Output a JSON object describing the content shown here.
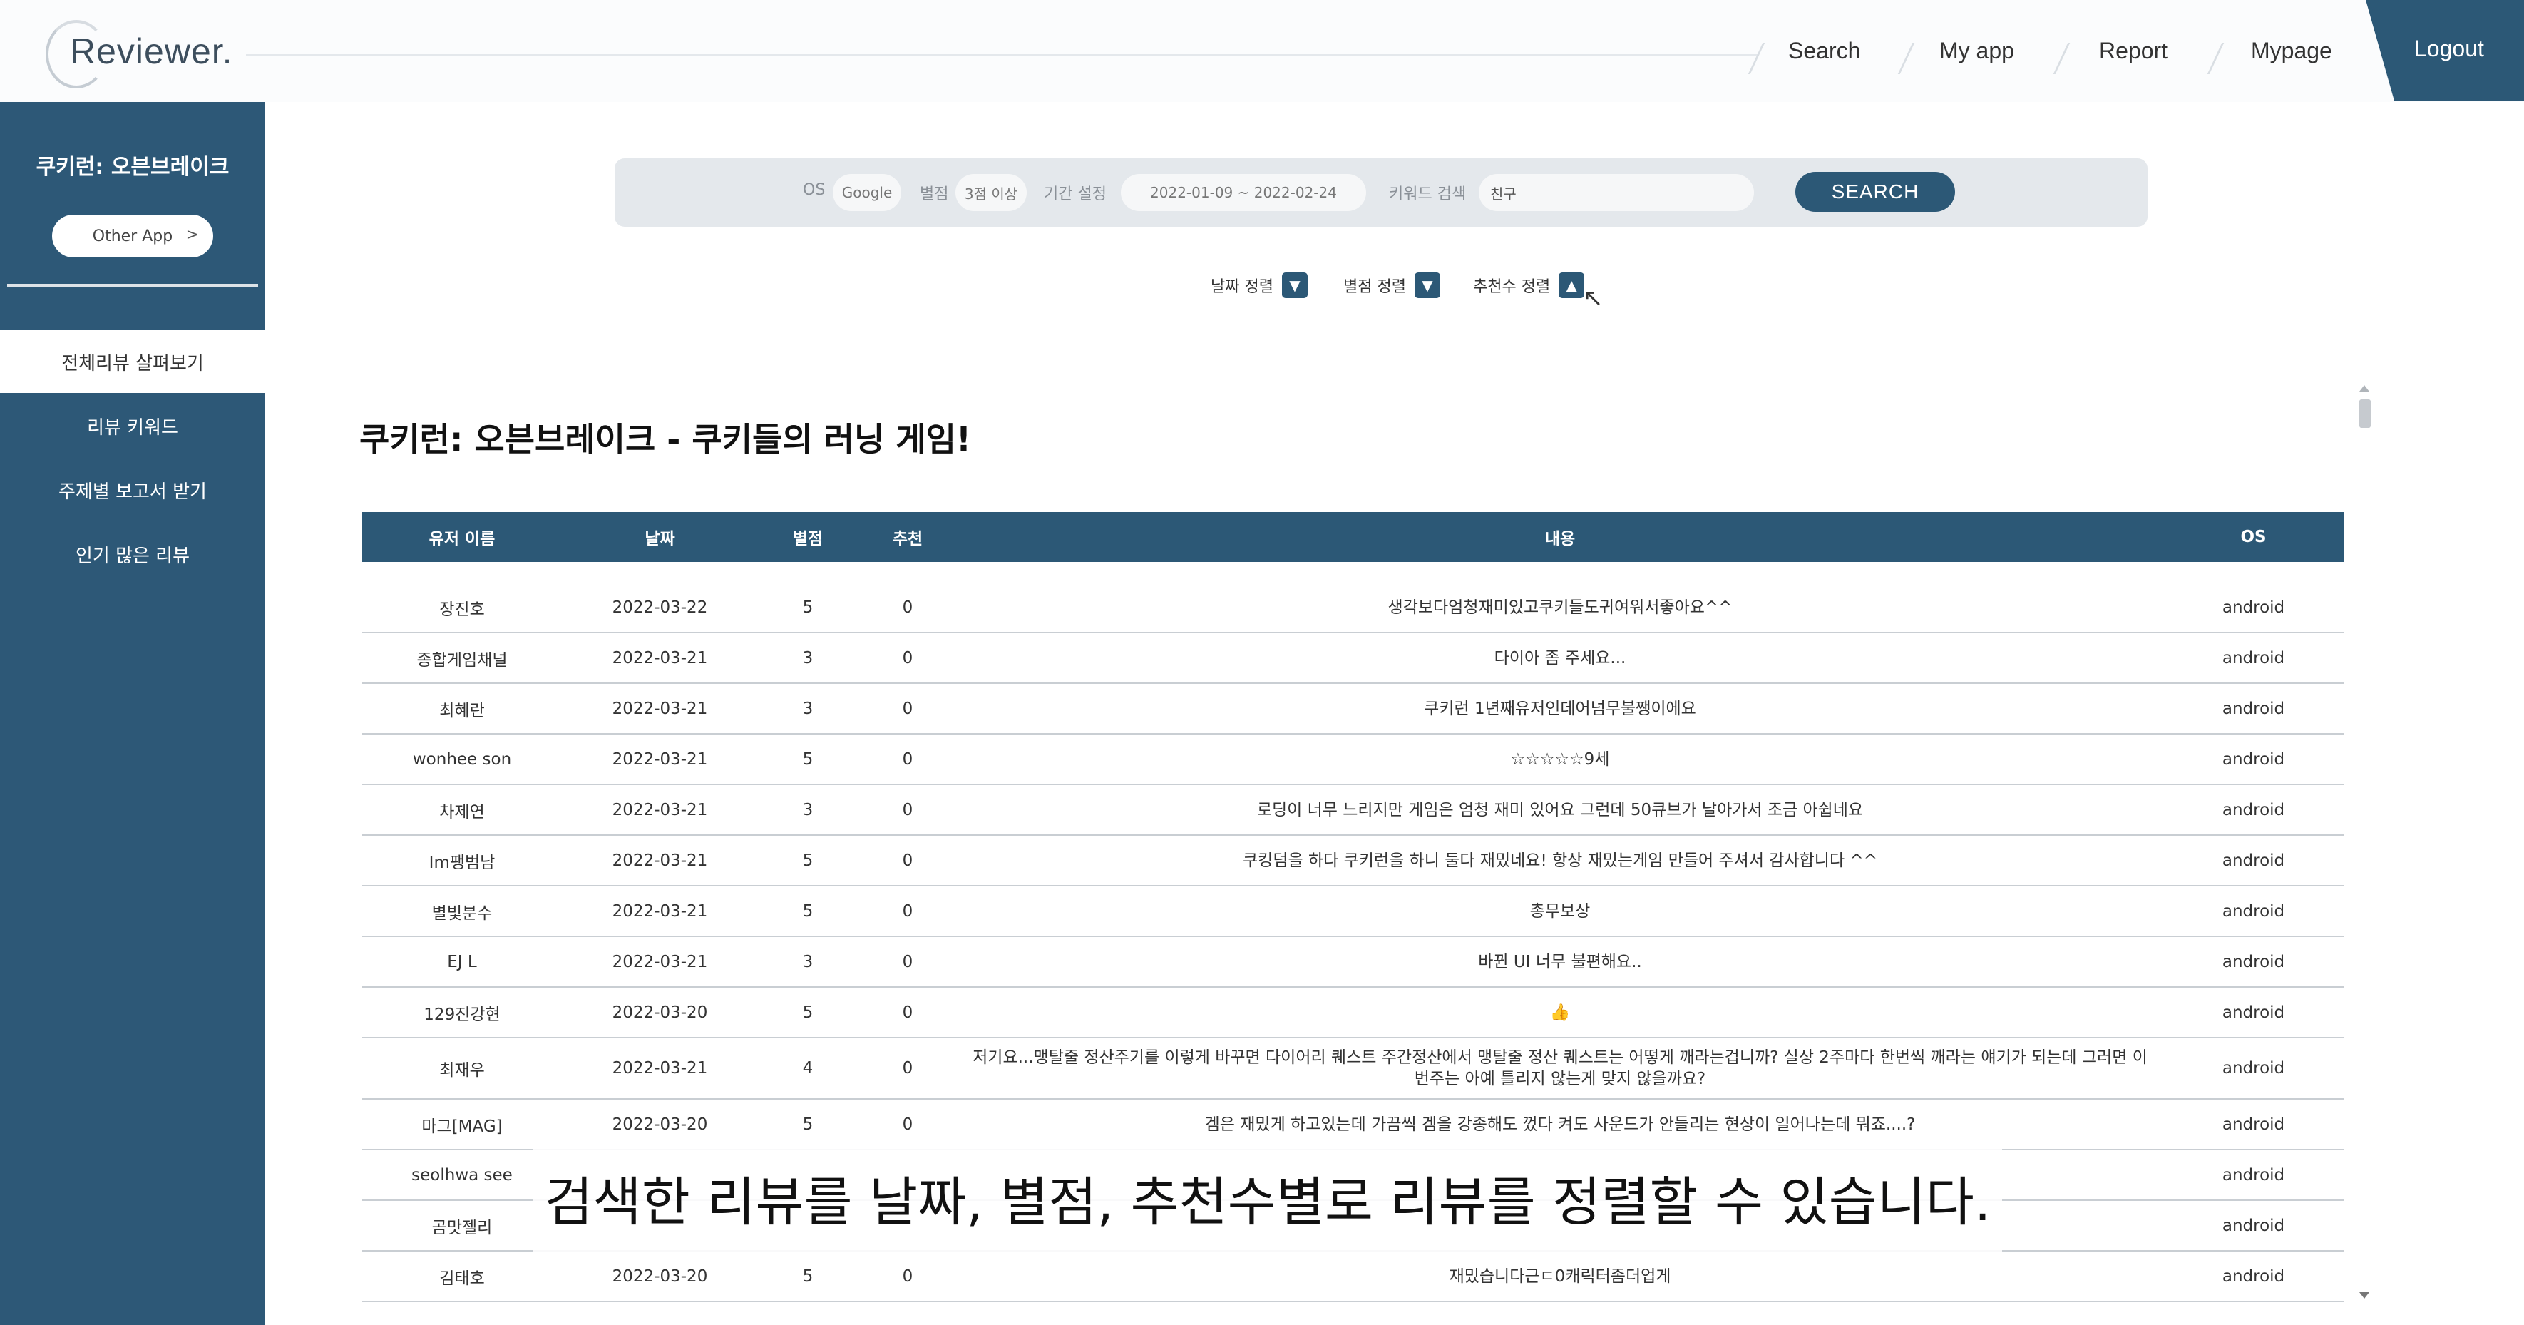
{
  "header": {
    "logo": "Reviewer.",
    "nav": [
      "Search",
      "My app",
      "Report",
      "Mypage"
    ],
    "logout": "Logout"
  },
  "sidebar": {
    "app_name": "쿠키런: 오븐브레이크",
    "other_app": "Other App",
    "other_app_arrow": ">",
    "items": [
      {
        "label": "전체리뷰 살펴보기",
        "active": true
      },
      {
        "label": "리뷰 키워드",
        "active": false
      },
      {
        "label": "주제별 보고서 받기",
        "active": false
      },
      {
        "label": "인기 많은 리뷰",
        "active": false
      }
    ]
  },
  "filter": {
    "os_label": "OS",
    "os_value": "Google",
    "rating_label": "별점",
    "rating_value": "3점 이상",
    "period_label": "기간 설정",
    "period_value": "2022-01-09 ~ 2022-02-24",
    "keyword_label": "키워드 검색",
    "keyword_value": "친구",
    "search_button": "SEARCH"
  },
  "sort": {
    "date": "날짜 정렬",
    "rating": "별점 정렬",
    "recommend": "추천수 정렬",
    "down_glyph": "▼",
    "up_glyph": "▲"
  },
  "page_title": "쿠키런: 오븐브레이크 - 쿠키들의 러닝 게임!",
  "table": {
    "headers": [
      "유저 이름",
      "날짜",
      "별점",
      "추천",
      "내용",
      "OS"
    ],
    "rows": [
      {
        "name": "장진호",
        "date": "2022-03-22",
        "rating": "5",
        "rec": "0",
        "content": "생각보다엄청재미있고쿠키들도귀여워서좋아요^^",
        "os": "android"
      },
      {
        "name": "종합게임채널",
        "date": "2022-03-21",
        "rating": "3",
        "rec": "0",
        "content": "다이아 좀 주세요...",
        "os": "android"
      },
      {
        "name": "최혜란",
        "date": "2022-03-21",
        "rating": "3",
        "rec": "0",
        "content": "쿠키런 1년째유저인데어넘무불쨍이에요",
        "os": "android"
      },
      {
        "name": "wonhee son",
        "date": "2022-03-21",
        "rating": "5",
        "rec": "0",
        "content": "☆☆☆☆☆9세",
        "os": "android"
      },
      {
        "name": "차제연",
        "date": "2022-03-21",
        "rating": "3",
        "rec": "0",
        "content": "로딩이 너무 느리지만 게임은 엄청 재미 있어요 그런데 50큐브가 날아가서 조금 아쉽네요",
        "os": "android"
      },
      {
        "name": "Im팽범남",
        "date": "2022-03-21",
        "rating": "5",
        "rec": "0",
        "content": "쿠킹덤을 하다 쿠키런을 하니 둘다 재밌네요! 항상 재밌는게임 만들어 주셔서 감사합니다 ^^",
        "os": "android"
      },
      {
        "name": "별빛분수",
        "date": "2022-03-21",
        "rating": "5",
        "rec": "0",
        "content": "총무보상",
        "os": "android"
      },
      {
        "name": "EJ L",
        "date": "2022-03-21",
        "rating": "3",
        "rec": "0",
        "content": "바뀐 UI 너무 불편해요..",
        "os": "android"
      },
      {
        "name": "129진강현",
        "date": "2022-03-20",
        "rating": "5",
        "rec": "0",
        "content": "👍",
        "os": "android"
      },
      {
        "name": "최재우",
        "date": "2022-03-21",
        "rating": "4",
        "rec": "0",
        "content": "저기요...맹탈줄 정산주기를 이렇게 바꾸면 다이어리 퀘스트 주간정산에서 맹탈줄 정산 퀘스트는 어떻게 깨라는겁니까? 실상 2주마다 한번씩 깨라는 얘기가 되는데 그러면 이번주는 아예 틀리지 않는게 맞지 않을까요?",
        "os": "android",
        "tall": true
      },
      {
        "name": "마그[MAG]",
        "date": "2022-03-20",
        "rating": "5",
        "rec": "0",
        "content": "겜은 재밌게 하고있는데 가끔씩 겜을 강종해도 껐다 켜도 사운드가 안들리는 현상이 일어나는데 뭐죠....?",
        "os": "android"
      },
      {
        "name": "seolhwa see",
        "date": "",
        "rating": "",
        "rec": "",
        "content": "",
        "os": "android"
      },
      {
        "name": "곰맛젤리",
        "date": "",
        "rating": "",
        "rec": "",
        "content": "",
        "os": "android"
      },
      {
        "name": "김태호",
        "date": "2022-03-20",
        "rating": "5",
        "rec": "0",
        "content": "재밌습니다근ㄷ0캐릭터좀더업게",
        "os": "android"
      }
    ]
  },
  "subtitle": "검색한 리뷰를 날짜, 별점, 추천수별로 리뷰를 정렬할 수 있습니다."
}
